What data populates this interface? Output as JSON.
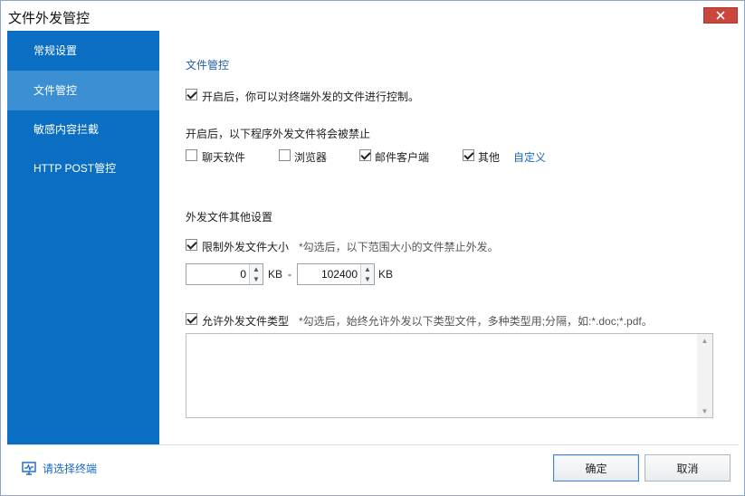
{
  "window": {
    "title": "文件外发管控"
  },
  "sidebar": {
    "items": [
      {
        "label": "常规设置"
      },
      {
        "label": "文件管控"
      },
      {
        "label": "敏感内容拦截"
      },
      {
        "label": "HTTP POST管控"
      }
    ],
    "active_index": 1
  },
  "file_control": {
    "section_title": "文件管控",
    "enable_label": "开启后，你可以对终端外发的文件进行控制。",
    "enable_checked": true,
    "programs_heading": "开启后，以下程序外发文件将会被禁止",
    "programs": [
      {
        "label": "聊天软件",
        "checked": false
      },
      {
        "label": "浏览器",
        "checked": false
      },
      {
        "label": "邮件客户端",
        "checked": true
      },
      {
        "label": "其他",
        "checked": true
      }
    ],
    "customize_link": "自定义"
  },
  "other_settings": {
    "heading": "外发文件其他设置",
    "limit_size": {
      "label": "限制外发文件大小",
      "checked": true,
      "hint": "*勾选后，以下范围大小的文件禁止外发。",
      "min_value": "0",
      "max_value": "102400",
      "unit": "KB",
      "separator": "-"
    },
    "allow_types": {
      "label": "允许外发文件类型",
      "checked": true,
      "hint": "*勾选后，始终允许外发以下类型文件，多种类型用;分隔，如:*.doc;*.pdf。",
      "value": ""
    }
  },
  "footer": {
    "select_terminal": "请选择终端",
    "ok_label": "确定",
    "cancel_label": "取消"
  }
}
